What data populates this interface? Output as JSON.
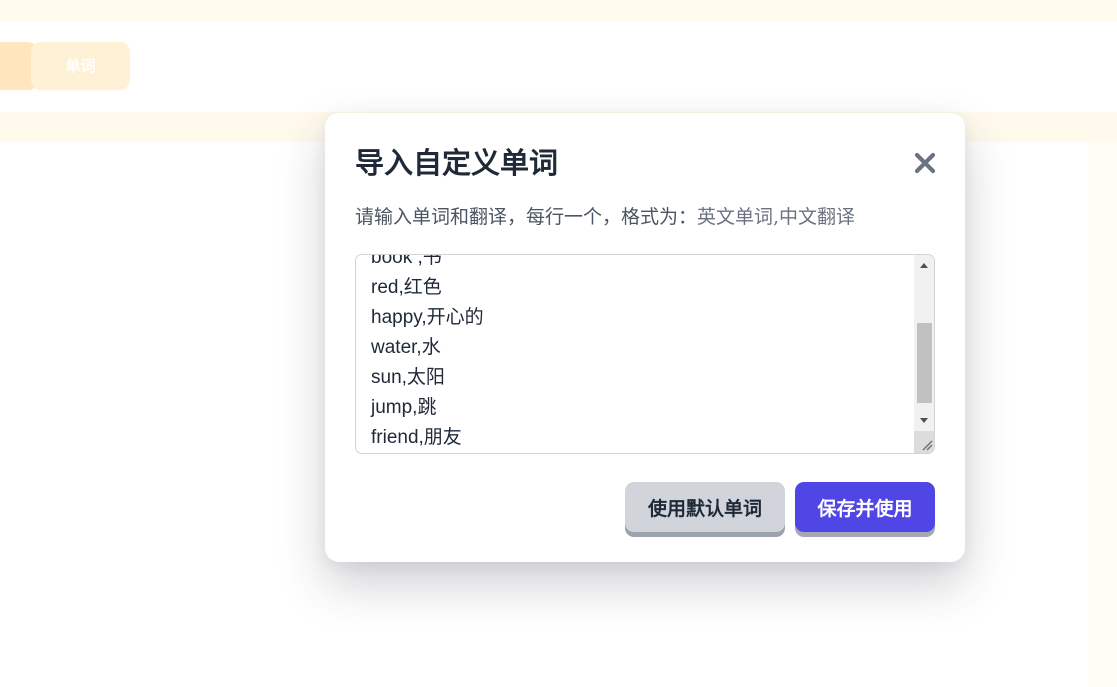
{
  "background": {
    "header_button_label": "单词"
  },
  "modal": {
    "title": "导入自定义单词",
    "description_prefix": "请输入单词和翻译，每行一个，格式为：",
    "description_format": "英文单词,中文翻译",
    "words": [
      "book ,书",
      "red,红色",
      "happy,开心的",
      "water,水",
      "sun,太阳",
      "jump,跳",
      "friend,朋友"
    ],
    "buttons": {
      "use_default": "使用默认单词",
      "save_and_use": "保存并使用"
    }
  },
  "icons": {
    "close": "close-icon",
    "scroll_up": "arrow-up-icon",
    "scroll_down": "arrow-down-icon",
    "resize": "resize-grip-icon"
  },
  "colors": {
    "primary": "#4f46e5",
    "secondary_button": "#d1d5db",
    "title": "#1f2937",
    "text_muted": "#4b5563",
    "background_accent": "#fff1d6"
  }
}
